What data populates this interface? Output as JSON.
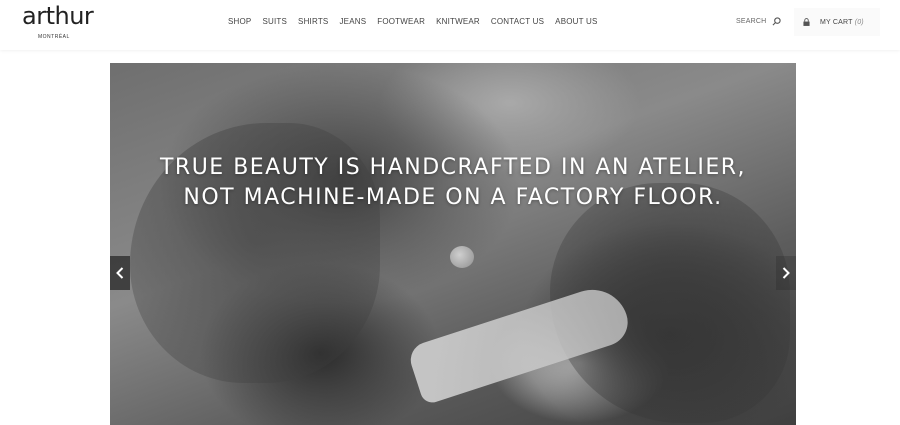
{
  "logo": {
    "word": "arthur",
    "sub": "MONTRÉAL"
  },
  "nav": {
    "items": [
      {
        "label": "SHOP"
      },
      {
        "label": "SUITS"
      },
      {
        "label": "SHIRTS"
      },
      {
        "label": "JEANS"
      },
      {
        "label": "FOOTWEAR"
      },
      {
        "label": "KNITWEAR"
      },
      {
        "label": "CONTACT US"
      },
      {
        "label": "ABOUT US"
      }
    ]
  },
  "search": {
    "label": "SEARCH",
    "icon": "search-icon"
  },
  "cart": {
    "label": "MY CART",
    "count": "(0)",
    "icon": "lock-icon"
  },
  "hero": {
    "caption_line1": "TRUE BEAUTY IS HANDCRAFTED IN AN ATELIER,",
    "caption_line2": "NOT MACHINE-MADE ON A FACTORY FLOOR.",
    "prev_icon": "chevron-left-icon",
    "next_icon": "chevron-right-icon"
  },
  "colors": {
    "text": "#222222",
    "nav": "#444444",
    "caption": "#ffffff"
  }
}
